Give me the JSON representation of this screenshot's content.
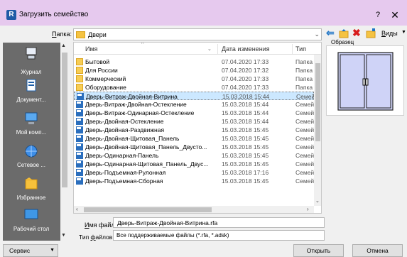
{
  "window": {
    "title": "Загрузить семейство",
    "help_glyph": "?",
    "close_glyph": "✕",
    "app_icon_letter": "R"
  },
  "toolbar": {
    "folder_label": "Папка:",
    "folder_value": "Двери",
    "views_label": "Виды"
  },
  "places": [
    {
      "label": "",
      "icon": "system-icon"
    },
    {
      "label": "Журнал",
      "icon": "history-icon"
    },
    {
      "label": "Документ...",
      "icon": "documents-icon"
    },
    {
      "label": "Мой комп...",
      "icon": "computer-icon"
    },
    {
      "label": "Сетевое ...",
      "icon": "network-icon"
    },
    {
      "label": "Избранное",
      "icon": "favorites-icon"
    },
    {
      "label": "Рабочий стол",
      "icon": "desktop-icon"
    }
  ],
  "filelist": {
    "columns": [
      "Имя",
      "Дата изменения",
      "Тип"
    ],
    "rows": [
      {
        "name": "Бытовой",
        "date": "07.04.2020 17:33",
        "type": "Папка",
        "kind": "folder"
      },
      {
        "name": "Для России",
        "date": "07.04.2020 17:32",
        "type": "Папка",
        "kind": "folder"
      },
      {
        "name": "Коммерческий",
        "date": "07.04.2020 17:33",
        "type": "Папка",
        "kind": "folder"
      },
      {
        "name": "Оборудование",
        "date": "07.04.2020 17:33",
        "type": "Папка",
        "kind": "folder"
      },
      {
        "name": "Дверь-Витраж-Двойная-Витрина",
        "date": "15.03.2018 15:44",
        "type": "Семей",
        "kind": "rfa",
        "selected": true
      },
      {
        "name": "Дверь-Витраж-Двойная-Остекление",
        "date": "15.03.2018 15:44",
        "type": "Семей",
        "kind": "rfa"
      },
      {
        "name": "Дверь-Витраж-Одинарная-Остекление",
        "date": "15.03.2018 15:44",
        "type": "Семей",
        "kind": "rfa"
      },
      {
        "name": "Дверь-Двойная-Остекление",
        "date": "15.03.2018 15:44",
        "type": "Семей",
        "kind": "rfa"
      },
      {
        "name": "Дверь-Двойная-Раздвижная",
        "date": "15.03.2018 15:45",
        "type": "Семей",
        "kind": "rfa"
      },
      {
        "name": "Дверь-Двойная-Щитовая_Панель",
        "date": "15.03.2018 15:45",
        "type": "Семей",
        "kind": "rfa"
      },
      {
        "name": "Дверь-Двойная-Щитовая_Панель_Двусто...",
        "date": "15.03.2018 15:45",
        "type": "Семей",
        "kind": "rfa"
      },
      {
        "name": "Дверь-Одинарная-Панель",
        "date": "15.03.2018 15:45",
        "type": "Семей",
        "kind": "rfa"
      },
      {
        "name": "Дверь-Одинарная-Щитовая_Панель_Двус...",
        "date": "15.03.2018 15:45",
        "type": "Семей",
        "kind": "rfa"
      },
      {
        "name": "Дверь-Подъемная-Рулонная",
        "date": "15.03.2018 17:16",
        "type": "Семей",
        "kind": "rfa"
      },
      {
        "name": "Дверь-Подъемная-Сборная",
        "date": "15.03.2018 15:45",
        "type": "Семей",
        "kind": "rfa"
      }
    ]
  },
  "preview": {
    "label": "Образец"
  },
  "filename": {
    "label": "Имя файла:",
    "value": "Дверь-Витраж-Двойная-Витрина.rfa"
  },
  "filetype": {
    "label": "Тип файлов:",
    "value": "Все поддерживаемые файлы  (*.rfa, *.adsk)"
  },
  "buttons": {
    "tools": "Сервис",
    "open": "Открыть",
    "cancel": "Отмена"
  },
  "colors": {
    "titlebar": "#e6c9ee",
    "places_bg": "#6b6b6b",
    "selection": "#cce8ff",
    "preview_glass": "#cfd3f7"
  }
}
